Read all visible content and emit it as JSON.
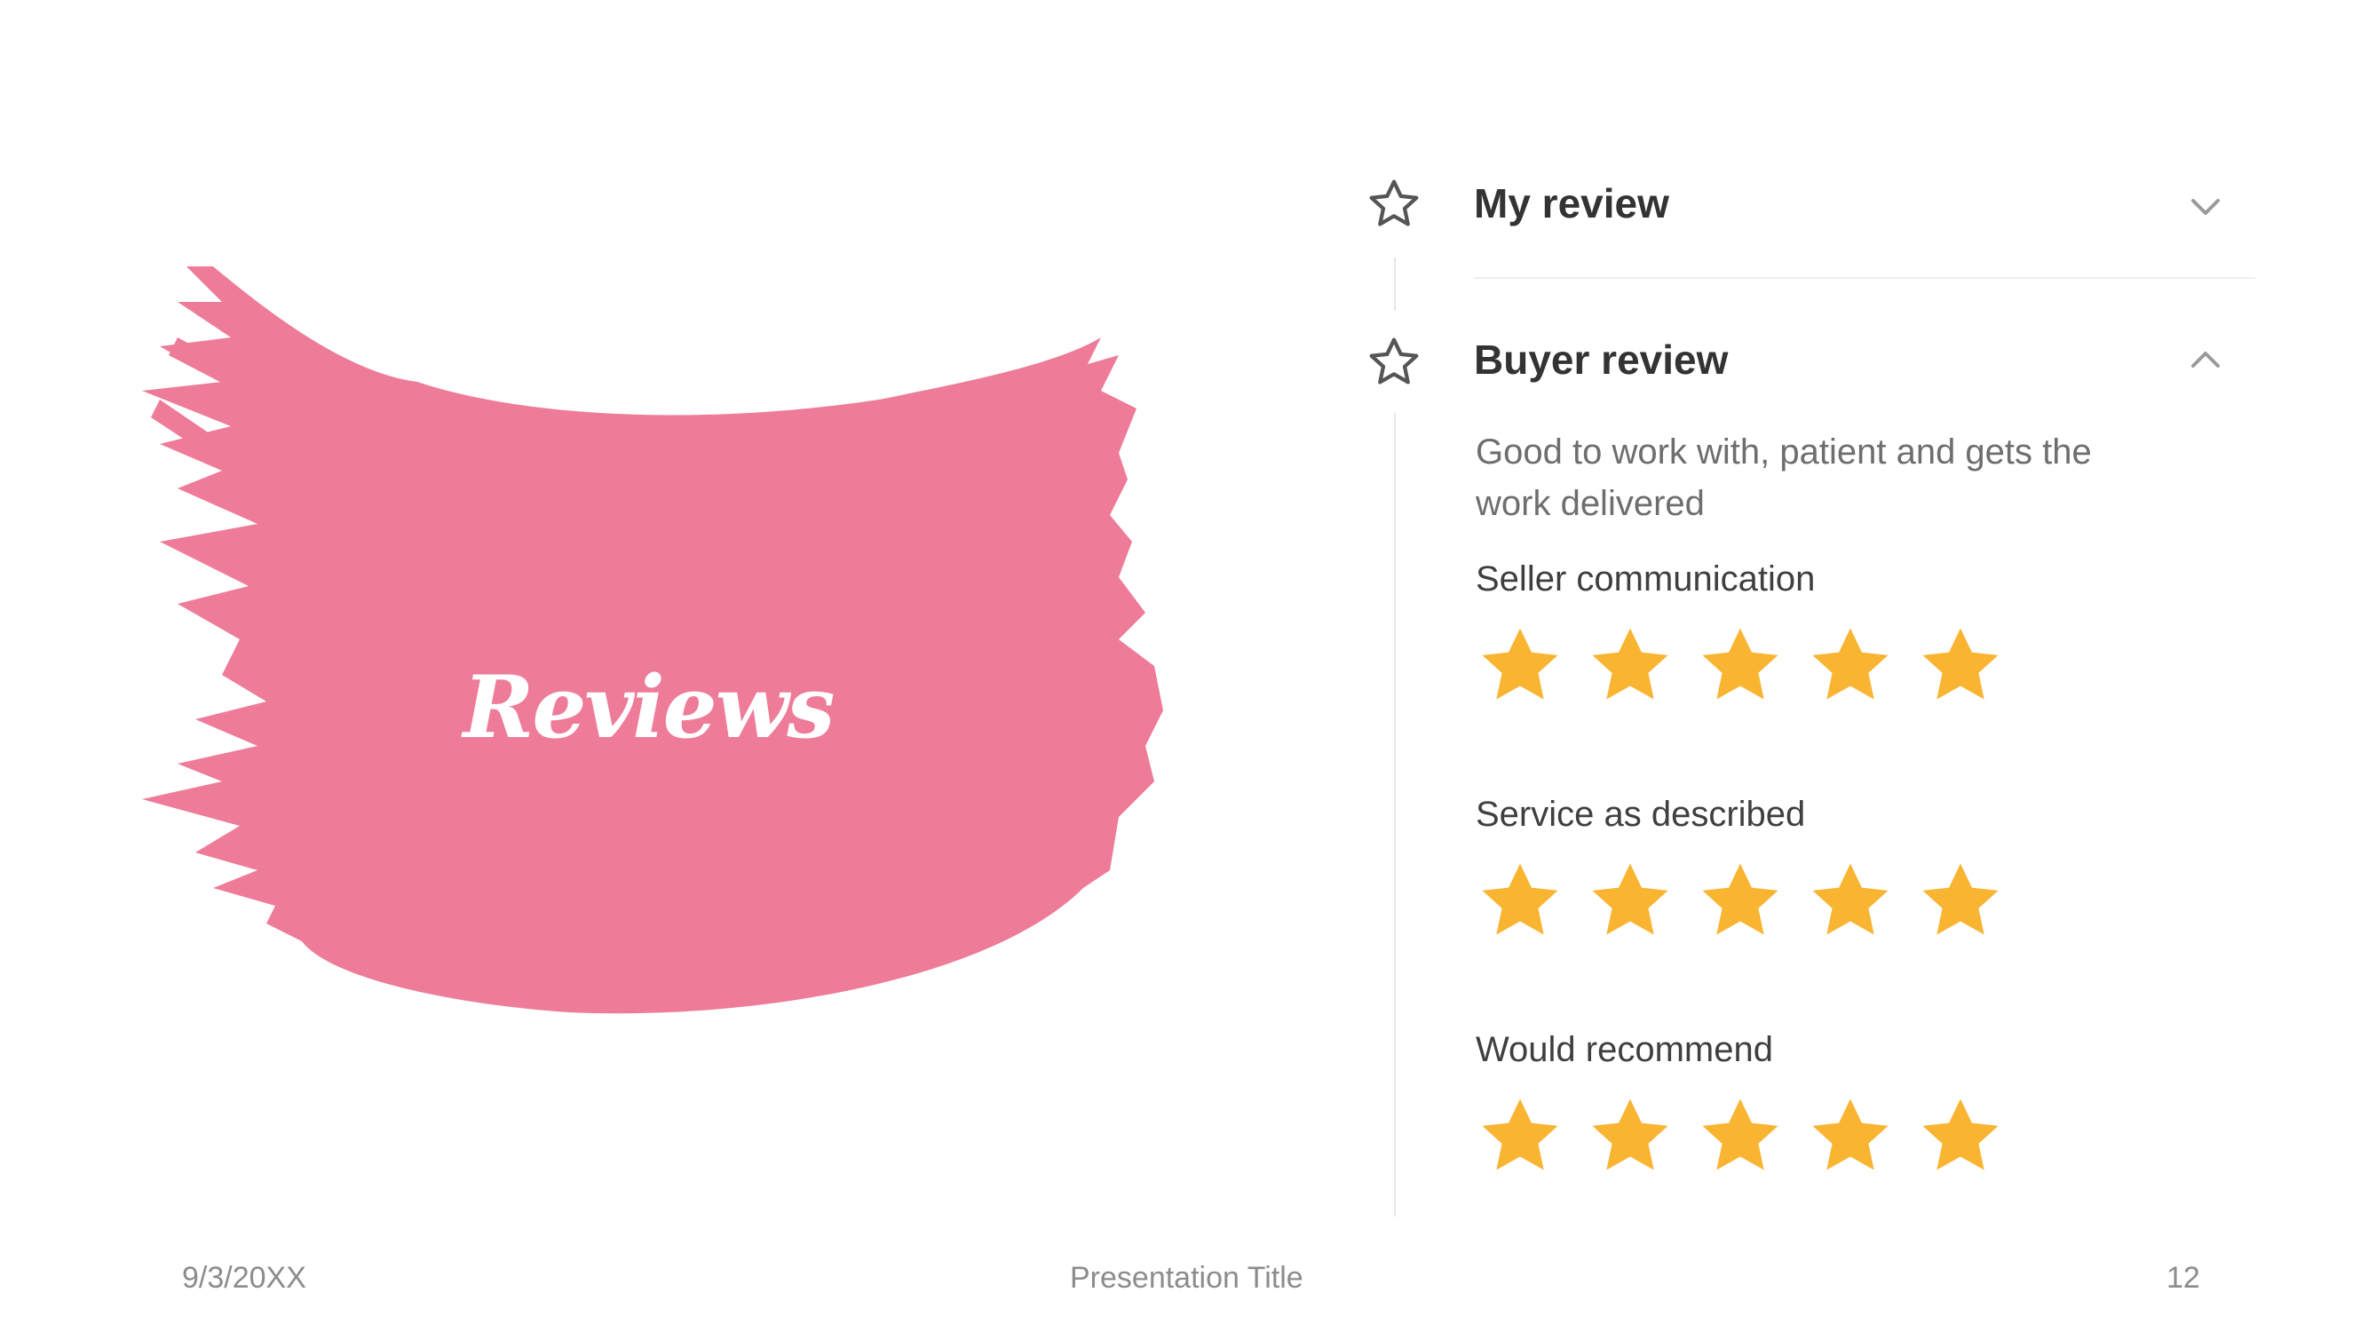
{
  "title": "Reviews",
  "colors": {
    "brush": "#ee7b98",
    "star": "#f9b431",
    "outline": "#555555"
  },
  "panel": {
    "my_review": {
      "title": "My review",
      "icon": "star-outline-icon",
      "chevron": "chevron-down-icon"
    },
    "buyer_review": {
      "title": "Buyer review",
      "icon": "star-outline-icon",
      "chevron": "chevron-up-icon",
      "description_line1": "Good to work with, patient and gets the",
      "description_line2": "work delivered",
      "criteria": [
        {
          "label": "Seller communication",
          "rating": 5,
          "max": 5
        },
        {
          "label": "Service as described",
          "rating": 5,
          "max": 5
        },
        {
          "label": "Would recommend",
          "rating": 5,
          "max": 5
        }
      ]
    }
  },
  "footer": {
    "date": "9/3/20XX",
    "title": "Presentation Title",
    "page": "12"
  }
}
